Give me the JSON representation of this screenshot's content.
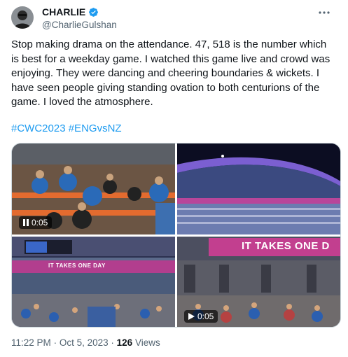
{
  "author": {
    "display_name": "CHARLIE",
    "handle": "@CharlieGulshan",
    "verified_icon": "verified-badge-icon",
    "verified_color": "#1d9bf0"
  },
  "tweet": {
    "text": "Stop making drama on the attendance. 47, 518 is the number which is best for a weekday game. I watched this game live and crowd was enjoying. They were dancing and cheering boundaries & wickets. I have seen people giving standing ovation to both centurions of the game. I loved the atmosphere.",
    "hashtags": [
      "#CWC2023",
      "#ENGvsNZ"
    ],
    "link_color": "#1d9bf0"
  },
  "media": {
    "videos": [
      {
        "timestamp": "0:05"
      },
      {
        "timestamp": "0:05"
      }
    ],
    "banner_text_top_right": "IT TAKES ONE D",
    "banner_text_bottom_left": "IT TAKES ONE DAY"
  },
  "meta": {
    "time": "11:22 PM",
    "date": "Oct 5, 2023",
    "separator": "·",
    "views_count": "126",
    "views_label": "Views"
  }
}
